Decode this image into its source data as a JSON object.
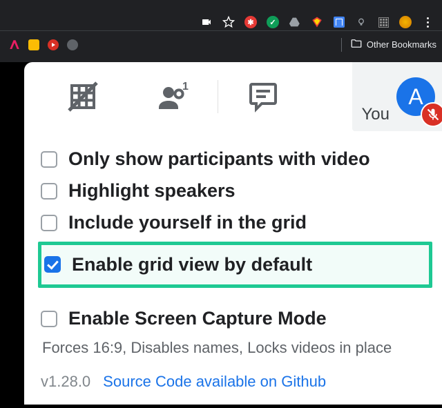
{
  "browser_chrome": {
    "other_bookmarks_label": "Other Bookmarks"
  },
  "you_chip": {
    "label": "You",
    "avatar_letter": "A",
    "avatar_bg": "#1a73e8",
    "muted": true
  },
  "options": [
    {
      "key": "only_video",
      "label": "Only show participants with video",
      "checked": false
    },
    {
      "key": "highlight_speakers",
      "label": "Highlight speakers",
      "checked": false
    },
    {
      "key": "include_self",
      "label": "Include yourself in the grid",
      "checked": false
    },
    {
      "key": "enable_default",
      "label": "Enable grid view by default",
      "checked": true,
      "highlighted": true
    }
  ],
  "screen_capture": {
    "label": "Enable Screen Capture Mode",
    "help": "Forces 16:9, Disables names, Locks videos in place",
    "checked": false
  },
  "footer": {
    "version": "v1.28.0",
    "link_text": "Source Code available on Github"
  }
}
